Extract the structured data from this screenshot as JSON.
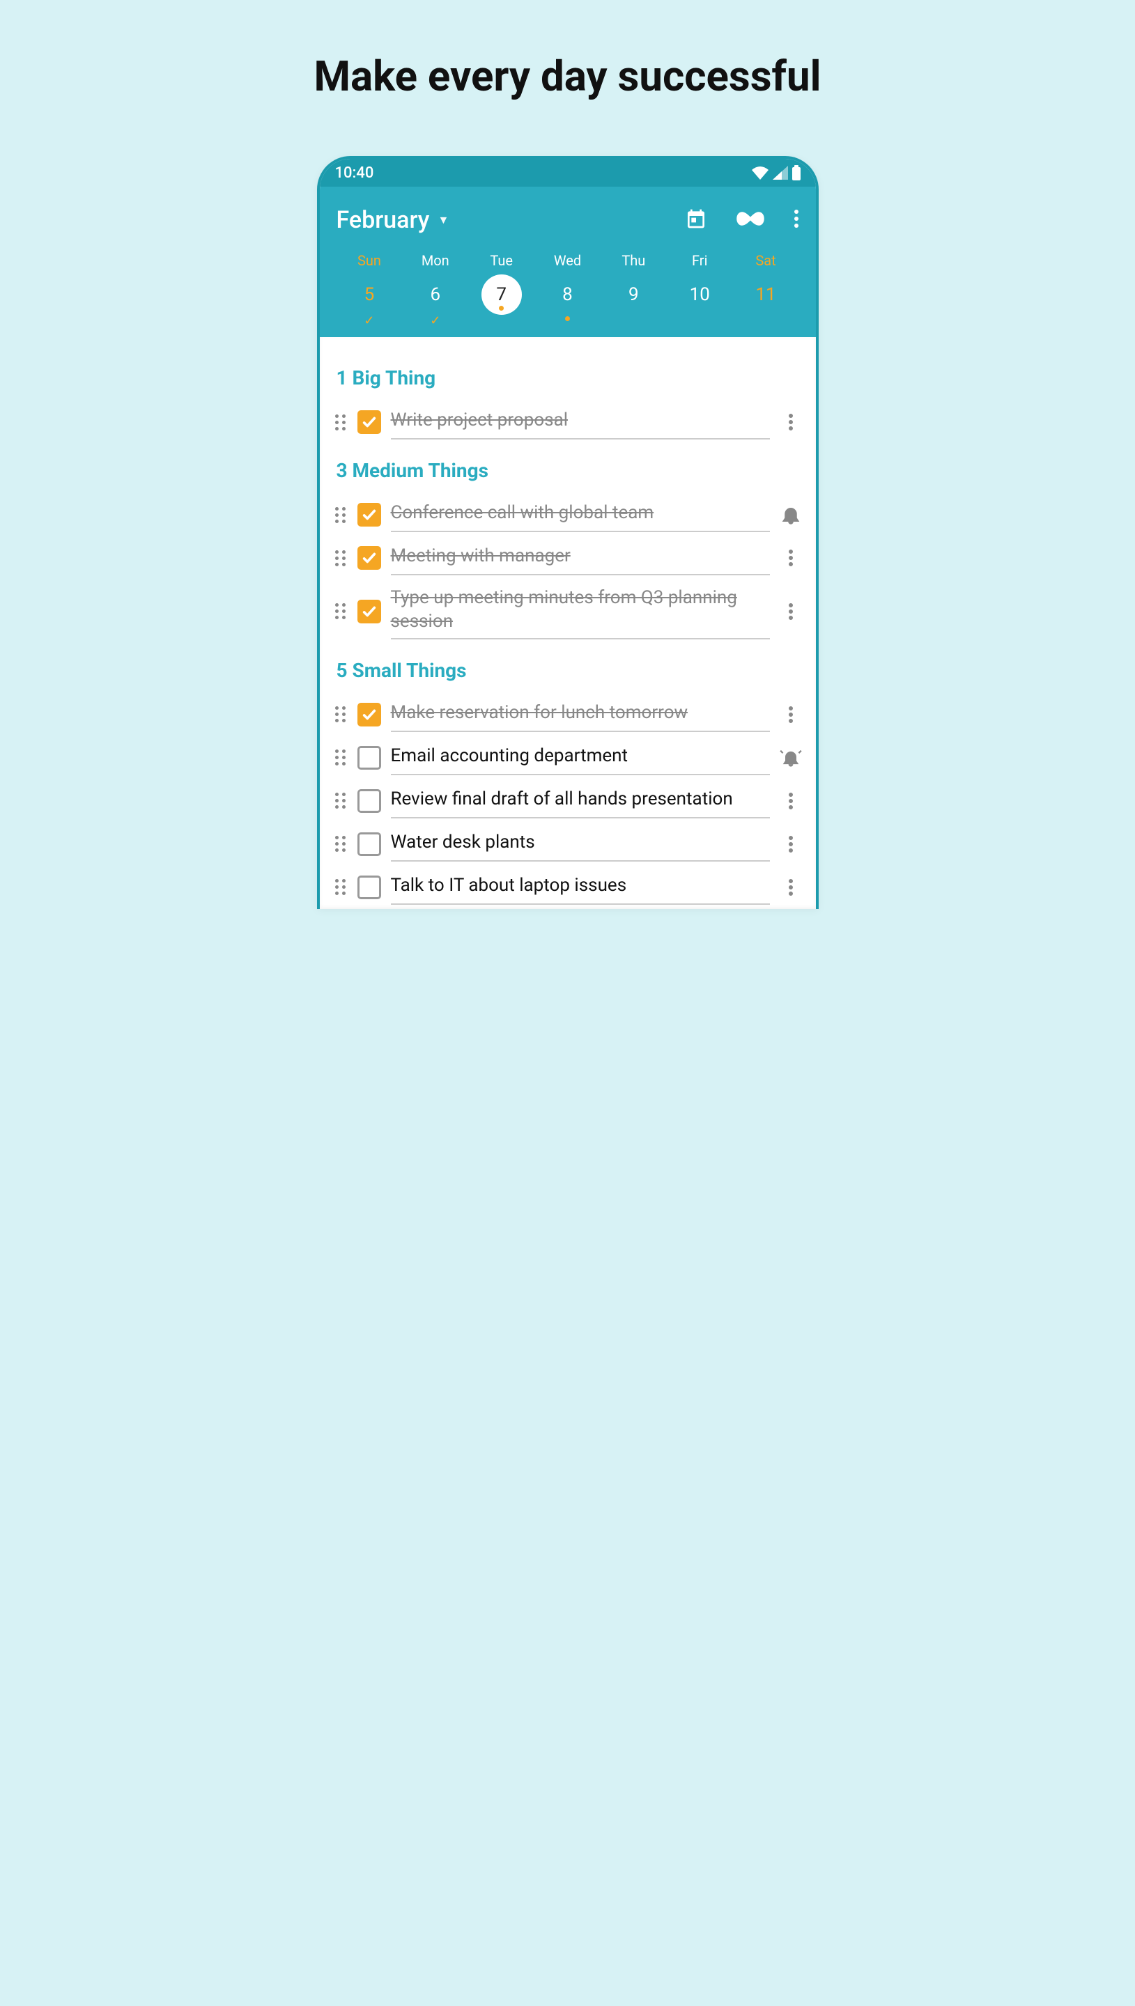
{
  "promo": {
    "title": "Make every day successful"
  },
  "status_bar": {
    "time": "10:40"
  },
  "header": {
    "month": "February"
  },
  "week": [
    {
      "name": "Sun",
      "num": "5",
      "weekend": true,
      "selected": false,
      "indicator": "tick"
    },
    {
      "name": "Mon",
      "num": "6",
      "weekend": false,
      "selected": false,
      "indicator": "tick"
    },
    {
      "name": "Tue",
      "num": "7",
      "weekend": false,
      "selected": true,
      "indicator": "dot-in"
    },
    {
      "name": "Wed",
      "num": "8",
      "weekend": false,
      "selected": false,
      "indicator": "dot"
    },
    {
      "name": "Thu",
      "num": "9",
      "weekend": false,
      "selected": false,
      "indicator": "none"
    },
    {
      "name": "Fri",
      "num": "10",
      "weekend": false,
      "selected": false,
      "indicator": "none"
    },
    {
      "name": "Sat",
      "num": "11",
      "weekend": true,
      "selected": false,
      "indicator": "none"
    }
  ],
  "sections": [
    {
      "title": "1 Big Thing",
      "tasks": [
        {
          "text": "Write project proposal",
          "done": true,
          "action": "more"
        }
      ]
    },
    {
      "title": "3 Medium Things",
      "tasks": [
        {
          "text": "Conference call with global team",
          "done": true,
          "action": "bell"
        },
        {
          "text": "Meeting with manager",
          "done": true,
          "action": "more"
        },
        {
          "text": "Type up meeting minutes from Q3 planning session",
          "done": true,
          "action": "more"
        }
      ]
    },
    {
      "title": "5 Small Things",
      "tasks": [
        {
          "text": "Make reservation for lunch tomorrow",
          "done": true,
          "action": "more"
        },
        {
          "text": "Email accounting department",
          "done": false,
          "action": "bell-ring"
        },
        {
          "text": "Review final draft of all hands presentation",
          "done": false,
          "action": "more"
        },
        {
          "text": "Water desk plants",
          "done": false,
          "action": "more"
        },
        {
          "text": "Talk to IT about laptop issues",
          "done": false,
          "action": "more"
        }
      ]
    }
  ]
}
